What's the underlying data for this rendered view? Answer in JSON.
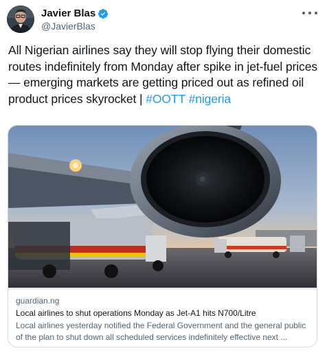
{
  "author": {
    "display_name": "Javier Blas",
    "handle": "@JavierBlas",
    "verified_color": "#1d9bf0"
  },
  "tweet": {
    "text": "All Nigerian airlines say they will stop flying their domestic routes indefinitely from Monday after spike in jet-fuel prices — emerging markets are getting priced out as refined oil product prices skyrocket |",
    "hashtags": [
      "#OOTT",
      "#nigeria"
    ]
  },
  "card": {
    "domain": "guardian.ng",
    "title": "Local airlines to shut operations Monday as Jet-A1 hits N700/Litre",
    "description_line1": "Local airlines yesterday notified the Federal Government and the general public",
    "description_line2": "of the plan to shut down all scheduled services indefinitely effective next ..."
  },
  "icons": {
    "more": "more-options-icon",
    "verified": "verified-badge-icon"
  },
  "colors": {
    "link": "#1d9bf0",
    "secondary_text": "#536471",
    "border": "#cfd9de"
  }
}
